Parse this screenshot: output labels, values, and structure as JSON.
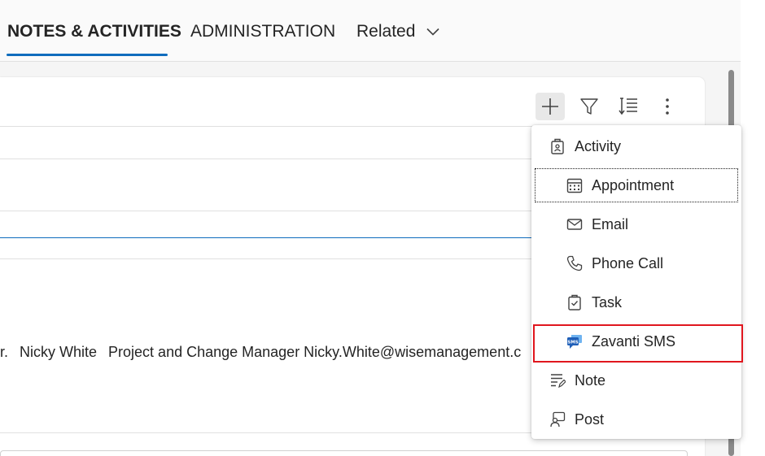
{
  "tabs": [
    {
      "label": "NOTES & ACTIVITIES"
    },
    {
      "label": "ADMINISTRATION"
    },
    {
      "label": "Related"
    }
  ],
  "toolbar": {
    "add_icon": "plus-icon",
    "filter_icon": "filter-icon",
    "sort_icon": "sort-icon",
    "more_icon": "more-vertical-icon"
  },
  "activity_text": {
    "prefix": "r.",
    "name": "Nicky White",
    "details": "Project and Change Manager Nicky.White@wisemanagement.c"
  },
  "menu": {
    "items": [
      {
        "label": "Activity",
        "icon": "activity-icon"
      },
      {
        "label": "Appointment",
        "icon": "calendar-icon"
      },
      {
        "label": "Email",
        "icon": "mail-icon"
      },
      {
        "label": "Phone Call",
        "icon": "phone-icon"
      },
      {
        "label": "Task",
        "icon": "task-clipboard-icon"
      },
      {
        "label": "Zavanti SMS",
        "icon": "sms-icon"
      },
      {
        "label": "Note",
        "icon": "note-icon"
      },
      {
        "label": "Post",
        "icon": "post-icon"
      }
    ]
  },
  "colors": {
    "accent": "#0f6cbd",
    "highlight": "#e0161e",
    "sms_icon": "#1f7ad1"
  }
}
